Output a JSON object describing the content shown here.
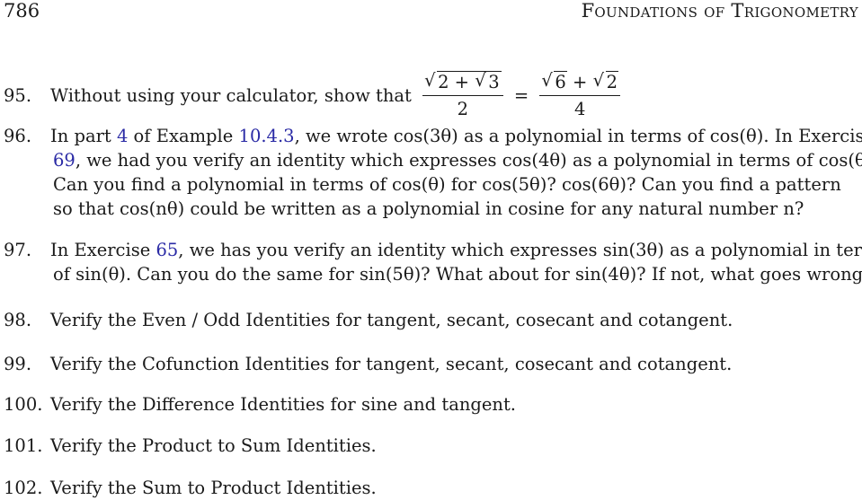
{
  "header": {
    "page_number": "786",
    "running_title": "Foundations of Trigonometry"
  },
  "exercises": [
    {
      "number": "95.",
      "text": "Without using your calculator, show that",
      "equation": {
        "lhs_numerator_a": "2 +",
        "lhs_numerator_b": "3",
        "lhs_numerator_outer": "2",
        "lhs_denominator": "2",
        "equals": "=",
        "rhs_numerator_a": "6",
        "rhs_plus": "+",
        "rhs_numerator_b": "2",
        "rhs_denominator": "4"
      }
    },
    {
      "number": "96.",
      "lines": [
        {
          "pre": "In part ",
          "link1": "4",
          "mid": " of Example ",
          "link2": "10.4.3",
          "post": ", we wrote cos(3θ) as a polynomial in terms of cos(θ). In Exercise"
        },
        {
          "link1": "69",
          "post": ", we had you verify an identity which expresses cos(4θ) as a polynomial in terms of cos(θ)."
        },
        {
          "text": "Can you find a polynomial in terms of cos(θ) for cos(5θ)? cos(6θ)? Can you find a pattern"
        },
        {
          "text": "so that cos(nθ) could be written as a polynomial in cosine for any natural number n?"
        }
      ]
    },
    {
      "number": "97.",
      "lines": [
        {
          "pre": "In Exercise ",
          "link1": "65",
          "post": ", we has you verify an identity which expresses sin(3θ) as a polynomial in terms"
        },
        {
          "text": "of sin(θ). Can you do the same for sin(5θ)? What about for sin(4θ)? If not, what goes wrong?"
        }
      ]
    },
    {
      "number": "98.",
      "text": "Verify the Even / Odd Identities for tangent, secant, cosecant and cotangent."
    },
    {
      "number": "99.",
      "text": "Verify the Cofunction Identities for tangent, secant, cosecant and cotangent."
    },
    {
      "number": "100.",
      "text": "Verify the Difference Identities for sine and tangent."
    },
    {
      "number": "101.",
      "text": "Verify the Product to Sum Identities."
    },
    {
      "number": "102.",
      "text": "Verify the Sum to Product Identities."
    }
  ],
  "colors": {
    "link": "#2a2aa5",
    "text": "#1a1a1a"
  }
}
